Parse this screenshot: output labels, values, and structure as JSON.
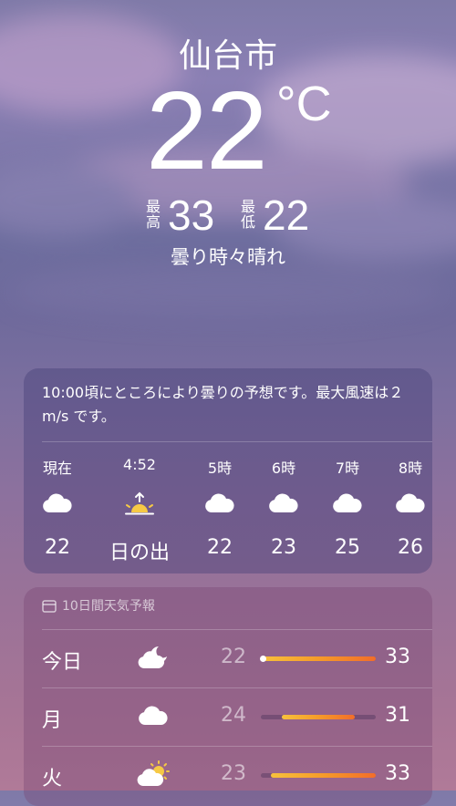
{
  "location": {
    "city": "仙台市"
  },
  "current": {
    "temperature": "22",
    "unit": "°C",
    "high_label": "最\n高",
    "high_label_top": "最",
    "high_label_bottom": "高",
    "high": "33",
    "low_label_top": "最",
    "low_label_bottom": "低",
    "low": "22",
    "condition": "曇り時々晴れ"
  },
  "hourly": {
    "summary": "10:00頃にところにより曇りの予想です。最大風速は２ m/s です。",
    "items": [
      {
        "time": "現在",
        "icon": "cloud-icon",
        "temp": "22"
      },
      {
        "time": "4:52",
        "icon": "sunrise-icon",
        "temp": "日の出"
      },
      {
        "time": "5時",
        "icon": "cloud-icon",
        "temp": "22"
      },
      {
        "time": "6時",
        "icon": "cloud-icon",
        "temp": "23"
      },
      {
        "time": "7時",
        "icon": "cloud-icon",
        "temp": "25"
      },
      {
        "time": "8時",
        "icon": "cloud-icon",
        "temp": "26"
      }
    ]
  },
  "forecast": {
    "title": "10日間天気予報",
    "days": [
      {
        "day": "今日",
        "icon": "cloudy-night-icon",
        "low": "22",
        "high": "33",
        "range_start": 0.0,
        "range_end": 1.0,
        "current_marker": true
      },
      {
        "day": "月",
        "icon": "cloud-icon",
        "low": "24",
        "high": "31",
        "range_start": 0.18,
        "range_end": 0.82,
        "current_marker": false
      },
      {
        "day": "火",
        "icon": "partly-sunny-icon",
        "low": "23",
        "high": "33",
        "range_start": 0.09,
        "range_end": 1.0,
        "current_marker": false
      }
    ]
  },
  "colors": {
    "bar_start": "#f7c13c",
    "bar_end": "#f26d2a",
    "sun": "#f6c945"
  }
}
